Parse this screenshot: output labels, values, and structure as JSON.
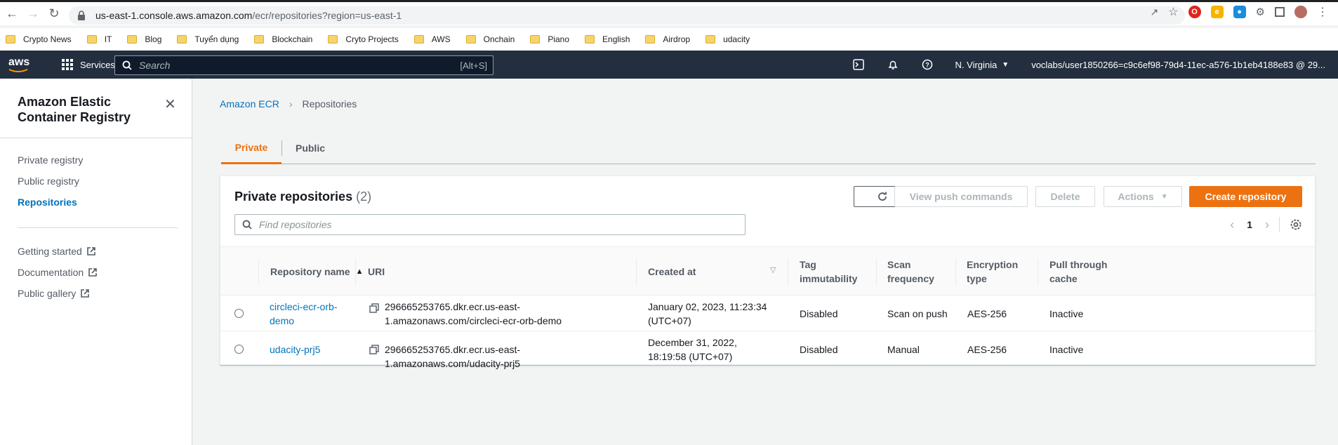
{
  "browser": {
    "url_host": "us-east-1.console.aws.amazon.com",
    "url_path": "/ecr/repositories?region=us-east-1"
  },
  "bookmarks": [
    "Crypto News",
    "IT",
    "Blog",
    "Tuyển dụng",
    "Blockchain",
    "Cryto Projects",
    "AWS",
    "Onchain",
    "Piano",
    "English",
    "Airdrop",
    "udacity"
  ],
  "awsnav": {
    "logo": "aws",
    "services_label": "Services",
    "search_placeholder": "Search",
    "search_shortcut": "[Alt+S]",
    "region": "N. Virginia",
    "account": "voclabs/user1850266=c9c6ef98-79d4-11ec-a576-1b1eb4188e83 @ 29..."
  },
  "sidebar": {
    "title": "Amazon Elastic Container Registry",
    "items": [
      {
        "label": "Private registry"
      },
      {
        "label": "Public registry"
      },
      {
        "label": "Repositories"
      }
    ],
    "external_items": [
      {
        "label": "Getting started"
      },
      {
        "label": "Documentation"
      },
      {
        "label": "Public gallery"
      }
    ]
  },
  "breadcrumb": {
    "root": "Amazon ECR",
    "current": "Repositories"
  },
  "tabs": [
    {
      "label": "Private",
      "active": true
    },
    {
      "label": "Public",
      "active": false
    }
  ],
  "panel": {
    "title": "Private repositories",
    "count": "(2)",
    "buttons": {
      "view_push": "View push commands",
      "delete": "Delete",
      "actions": "Actions",
      "create": "Create repository"
    },
    "filter_placeholder": "Find repositories",
    "page": "1"
  },
  "table": {
    "columns": {
      "name": "Repository name",
      "uri": "URI",
      "created": "Created at",
      "tag": "Tag immutability",
      "scan": "Scan frequency",
      "enc": "Encryption type",
      "pull": "Pull through cache"
    },
    "rows": [
      {
        "name": "circleci-ecr-orb-demo",
        "uri": "296665253765.dkr.ecr.us-east-1.amazonaws.com/circleci-ecr-orb-demo",
        "created": "January 02, 2023, 11:23:34 (UTC+07)",
        "tag": "Disabled",
        "scan": "Scan on push",
        "enc": "AES-256",
        "pull": "Inactive"
      },
      {
        "name": "udacity-prj5",
        "uri": "296665253765.dkr.ecr.us-east-1.amazonaws.com/udacity-prj5",
        "created": "December 31, 2022, 18:19:58 (UTC+07)",
        "tag": "Disabled",
        "scan": "Manual",
        "enc": "AES-256",
        "pull": "Inactive"
      }
    ]
  },
  "colors": {
    "accent": "#ec7211",
    "link": "#0073bb",
    "nav_bg": "#232f3e"
  }
}
